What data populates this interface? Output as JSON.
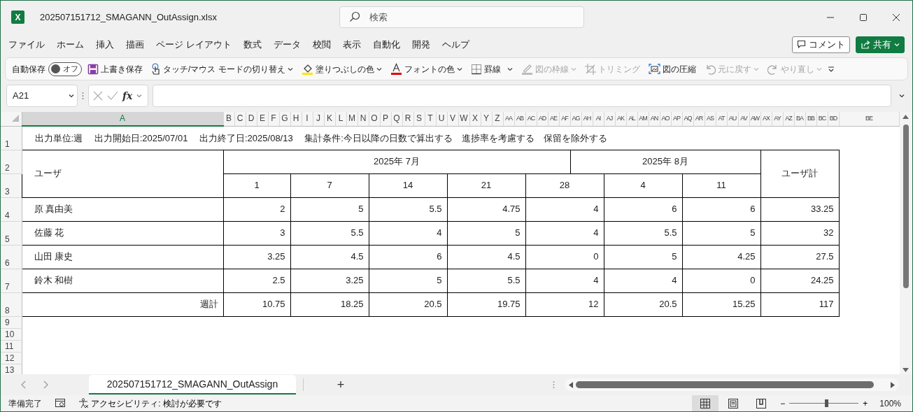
{
  "window": {
    "app_logo": "X",
    "title": "202507151712_SMAGANN_OutAssign.xlsx",
    "search": {
      "placeholder": "検索"
    }
  },
  "menu": [
    {
      "label": "ファイル"
    },
    {
      "label": "ホーム"
    },
    {
      "label": "挿入"
    },
    {
      "label": "描画"
    },
    {
      "label": "ページ レイアウト"
    },
    {
      "label": "数式"
    },
    {
      "label": "データ"
    },
    {
      "label": "校閲"
    },
    {
      "label": "表示"
    },
    {
      "label": "自動化"
    },
    {
      "label": "開発"
    },
    {
      "label": "ヘルプ"
    }
  ],
  "actions": [
    {
      "kind": "outline",
      "label": "コメント"
    },
    {
      "kind": "primary",
      "label": "共有"
    }
  ],
  "toolbar": [
    {
      "kind": "toggle",
      "label": "自動保存",
      "state_text": "オフ",
      "on": false
    },
    {
      "kind": "button",
      "label": "上書き保存",
      "disabled": false
    },
    {
      "kind": "dropdown",
      "label": "タッチ/マウス モードの切り替え",
      "disabled": false
    },
    {
      "kind": "dropdown",
      "label": "塗りつぶしの色",
      "disabled": false
    },
    {
      "kind": "dropdown",
      "label": "フォントの色",
      "disabled": false
    },
    {
      "kind": "split",
      "label": "罫線",
      "disabled": false
    },
    {
      "kind": "dropdown",
      "label": "図の枠線",
      "disabled": true
    },
    {
      "kind": "button",
      "label": "トリミング",
      "disabled": true
    },
    {
      "kind": "button",
      "label": "図の圧縮",
      "disabled": false
    },
    {
      "kind": "dropdown",
      "label": "元に戻す",
      "disabled": true
    },
    {
      "kind": "dropdown",
      "label": "やり直し",
      "disabled": true
    }
  ],
  "formula_bar": {
    "name_box": "A21",
    "function_label": "fx"
  },
  "sheet": {
    "columns": [
      {
        "label": "A",
        "selected": true
      },
      {
        "label": "B",
        "selected": false
      },
      {
        "label": "C",
        "selected": false
      },
      {
        "label": "D",
        "selected": false
      },
      {
        "label": "E",
        "selected": false
      },
      {
        "label": "F",
        "selected": false
      },
      {
        "label": "G",
        "selected": false
      },
      {
        "label": "H",
        "selected": false
      },
      {
        "label": "I",
        "selected": false
      },
      {
        "label": "J",
        "selected": false
      },
      {
        "label": "K",
        "selected": false
      },
      {
        "label": "L",
        "selected": false
      },
      {
        "label": "M",
        "selected": false
      },
      {
        "label": "N",
        "selected": false
      },
      {
        "label": "O",
        "selected": false
      },
      {
        "label": "P",
        "selected": false
      },
      {
        "label": "Q",
        "selected": false
      },
      {
        "label": "R",
        "selected": false
      },
      {
        "label": "S",
        "selected": false
      },
      {
        "label": "T",
        "selected": false
      },
      {
        "label": "U",
        "selected": false
      },
      {
        "label": "V",
        "selected": false
      },
      {
        "label": "W",
        "selected": false
      },
      {
        "label": "X",
        "selected": false
      },
      {
        "label": "Y",
        "selected": false
      },
      {
        "label": "Z",
        "selected": false
      },
      {
        "label": "AA",
        "selected": false
      },
      {
        "label": "AB",
        "selected": false
      },
      {
        "label": "AC",
        "selected": false
      },
      {
        "label": "AD",
        "selected": false
      },
      {
        "label": "AE",
        "selected": false
      },
      {
        "label": "AF",
        "selected": false
      },
      {
        "label": "AG",
        "selected": false
      },
      {
        "label": "AH",
        "selected": false
      },
      {
        "label": "AI",
        "selected": false
      },
      {
        "label": "AJ",
        "selected": false
      },
      {
        "label": "AK",
        "selected": false
      },
      {
        "label": "AL",
        "selected": false
      },
      {
        "label": "AM",
        "selected": false
      },
      {
        "label": "AN",
        "selected": false
      },
      {
        "label": "AO",
        "selected": false
      },
      {
        "label": "AP",
        "selected": false
      },
      {
        "label": "AQ",
        "selected": false
      },
      {
        "label": "AR",
        "selected": false
      },
      {
        "label": "AS",
        "selected": false
      },
      {
        "label": "AT",
        "selected": false
      },
      {
        "label": "AU",
        "selected": false
      },
      {
        "label": "AV",
        "selected": false
      },
      {
        "label": "AW",
        "selected": false
      },
      {
        "label": "AX",
        "selected": false
      },
      {
        "label": "AY",
        "selected": false
      },
      {
        "label": "AZ",
        "selected": false
      },
      {
        "label": "BA",
        "selected": false
      },
      {
        "label": "BB",
        "selected": false
      },
      {
        "label": "BC",
        "selected": false
      },
      {
        "label": "BD",
        "selected": false
      },
      {
        "label": "BE",
        "selected": false
      }
    ],
    "rows": [
      {
        "label": "1"
      },
      {
        "label": "2"
      },
      {
        "label": "3"
      },
      {
        "label": "4"
      },
      {
        "label": "5"
      },
      {
        "label": "6"
      },
      {
        "label": "7"
      },
      {
        "label": "8"
      },
      {
        "label": "9"
      },
      {
        "label": "10"
      },
      {
        "label": "11"
      },
      {
        "label": "12"
      },
      {
        "label": "13"
      }
    ],
    "note": "出力単位:週　 出力開始日:2025/07/01　 出力終了日:2025/08/13　 集計条件:今日以降の日数で算出する　進捗率を考慮する　保留を除外する",
    "table": {
      "user_header": "ユーザ",
      "months": [
        {
          "label": "2025年 7月"
        },
        {
          "label": "2025年 8月"
        }
      ],
      "weeks": [
        "1",
        "7",
        "14",
        "21",
        "28",
        "4",
        "11"
      ],
      "total_header": "ユーザ計",
      "rows": [
        {
          "name": "原 真由美",
          "values": [
            "2",
            "5",
            "5.5",
            "4.75",
            "4",
            "6",
            "6"
          ],
          "total": "33.25"
        },
        {
          "name": "佐藤 花",
          "values": [
            "3",
            "5.5",
            "4",
            "5",
            "4",
            "5.5",
            "5"
          ],
          "total": "32"
        },
        {
          "name": "山田 康史",
          "values": [
            "3.25",
            "4.5",
            "6",
            "4.5",
            "0",
            "5",
            "4.25"
          ],
          "total": "27.5"
        },
        {
          "name": "鈴木 和樹",
          "values": [
            "2.5",
            "3.25",
            "5",
            "5.5",
            "4",
            "4",
            "0"
          ],
          "total": "24.25"
        }
      ],
      "footer": {
        "label": "週計",
        "values": [
          "10.75",
          "18.25",
          "20.5",
          "19.75",
          "12",
          "20.5",
          "15.25"
        ],
        "total": "117"
      }
    }
  },
  "sheet_tabs": [
    {
      "label": "202507151712_SMAGANN_OutAssign",
      "selected": true
    }
  ],
  "add_sheet": "+",
  "status_bar": {
    "status": "準備完了",
    "accessibility": "アクセシビリティ: 検討が必要です",
    "views": [
      {
        "selected": true
      },
      {
        "selected": false
      },
      {
        "selected": false
      }
    ],
    "zoom": {
      "minus": "−",
      "plus": "+",
      "level": 0.53,
      "reading": "100%"
    }
  }
}
